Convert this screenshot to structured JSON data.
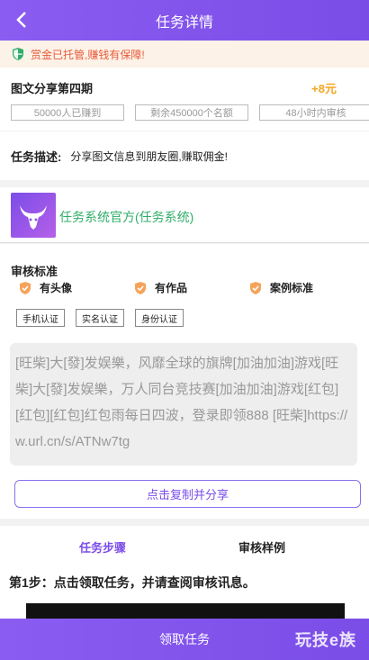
{
  "header": {
    "title": "任务详情"
  },
  "notice": {
    "text": "赏金已托管,赚钱有保障!"
  },
  "task": {
    "name": "图文分享第四期",
    "reward": "+8元",
    "tags": [
      "50000人已赚到",
      "剩余450000个名额",
      "48小时内审核"
    ]
  },
  "description": {
    "label": "任务描述:",
    "value": "分享图文信息到朋友圈,赚取佣金!"
  },
  "official": {
    "name": "任务系统官方(任务系统)"
  },
  "review": {
    "heading": "审核标准",
    "badges": [
      "有头像",
      "有作品",
      "案例标准"
    ],
    "certs": [
      "手机认证",
      "实名认证",
      "身份认证"
    ],
    "share_text": "[旺柴]大[發]发娱樂，风靡全球的旗牌[加油加油]游戏[旺柴]大[發]发娱樂，万人同台竞技赛[加油加油]游戏[红包][红包][红包]红包雨每日四波，登录即领888 [旺柴]https://w.url.cn/s/ATNw7tg",
    "copy_button": "点击复制并分享"
  },
  "steps": {
    "tabs": [
      "任务步骤",
      "审核样例"
    ],
    "step1": "第1步：点击领取任务，并请查阅审核讯息。"
  },
  "footer": {
    "button": "领取任务",
    "watermark": "玩技e族"
  },
  "colors": {
    "primary": "#7b4de8",
    "reward": "#f5a623",
    "official": "#2fae6a",
    "notice": "#e85a3a"
  },
  "icons": {
    "back": "chevron-left-icon",
    "shield": "shield-check-icon",
    "badge": "badge-check-icon",
    "avatar": "bull-logo-icon"
  }
}
